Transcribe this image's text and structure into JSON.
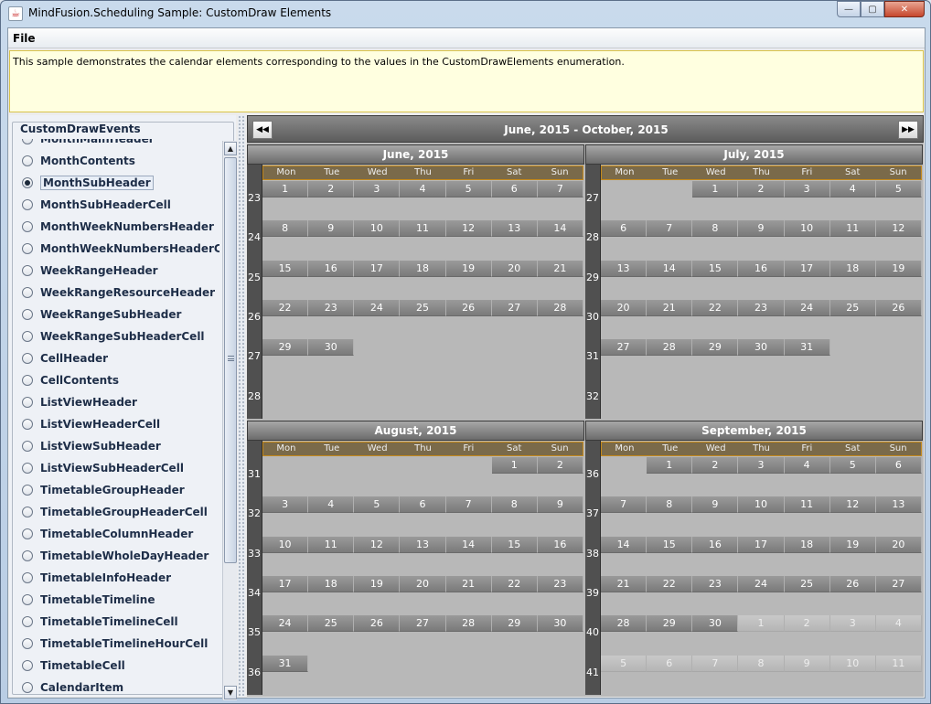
{
  "window": {
    "title": "MindFusion.Scheduling Sample: CustomDraw Elements",
    "icon": "java-cup-icon",
    "min_glyph": "—",
    "max_glyph": "▢",
    "close_glyph": "✕"
  },
  "menu": {
    "file": "File"
  },
  "description": "This sample demonstrates the calendar elements corresponding to the values in the CustomDrawElements enumeration.",
  "left": {
    "group_title": "CustomDrawEvents",
    "selected": "MonthSubHeader",
    "items": [
      {
        "label": "MonthMainHeader",
        "checked": false
      },
      {
        "label": "MonthContents",
        "checked": false
      },
      {
        "label": "MonthSubHeader",
        "checked": true
      },
      {
        "label": "MonthSubHeaderCell",
        "checked": false
      },
      {
        "label": "MonthWeekNumbersHeader",
        "checked": false
      },
      {
        "label": "MonthWeekNumbersHeaderCell",
        "checked": false
      },
      {
        "label": "WeekRangeHeader",
        "checked": false
      },
      {
        "label": "WeekRangeResourceHeader",
        "checked": false
      },
      {
        "label": "WeekRangeSubHeader",
        "checked": false
      },
      {
        "label": "WeekRangeSubHeaderCell",
        "checked": false
      },
      {
        "label": "CellHeader",
        "checked": false
      },
      {
        "label": "CellContents",
        "checked": false
      },
      {
        "label": "ListViewHeader",
        "checked": false
      },
      {
        "label": "ListViewHeaderCell",
        "checked": false
      },
      {
        "label": "ListViewSubHeader",
        "checked": false
      },
      {
        "label": "ListViewSubHeaderCell",
        "checked": false
      },
      {
        "label": "TimetableGroupHeader",
        "checked": false
      },
      {
        "label": "TimetableGroupHeaderCell",
        "checked": false
      },
      {
        "label": "TimetableColumnHeader",
        "checked": false
      },
      {
        "label": "TimetableWholeDayHeader",
        "checked": false
      },
      {
        "label": "TimetableInfoHeader",
        "checked": false
      },
      {
        "label": "TimetableTimeline",
        "checked": false
      },
      {
        "label": "TimetableTimelineCell",
        "checked": false
      },
      {
        "label": "TimetableTimelineHourCell",
        "checked": false
      },
      {
        "label": "TimetableCell",
        "checked": false
      },
      {
        "label": "CalendarItem",
        "checked": false
      }
    ]
  },
  "calendar": {
    "range_title": "June, 2015 - October, 2015",
    "prev_glyph": "◀◀",
    "next_glyph": "▶▶",
    "weekdays": [
      "Mon",
      "Tue",
      "Wed",
      "Thu",
      "Fri",
      "Sat",
      "Sun"
    ],
    "months": [
      {
        "title": "June, 2015",
        "week_numbers": [
          "23",
          "24",
          "25",
          "26",
          "27",
          "28"
        ],
        "rows": [
          [
            [
              "1",
              1
            ],
            [
              "2",
              1
            ],
            [
              "3",
              1
            ],
            [
              "4",
              1
            ],
            [
              "5",
              1
            ],
            [
              "6",
              1
            ],
            [
              "7",
              1
            ]
          ],
          [
            [
              "8",
              1
            ],
            [
              "9",
              1
            ],
            [
              "10",
              1
            ],
            [
              "11",
              1
            ],
            [
              "12",
              1
            ],
            [
              "13",
              1
            ],
            [
              "14",
              1
            ]
          ],
          [
            [
              "15",
              1
            ],
            [
              "16",
              1
            ],
            [
              "17",
              1
            ],
            [
              "18",
              1
            ],
            [
              "19",
              1
            ],
            [
              "20",
              1
            ],
            [
              "21",
              1
            ]
          ],
          [
            [
              "22",
              1
            ],
            [
              "23",
              1
            ],
            [
              "24",
              1
            ],
            [
              "25",
              1
            ],
            [
              "26",
              1
            ],
            [
              "27",
              1
            ],
            [
              "28",
              1
            ]
          ],
          [
            [
              "29",
              1
            ],
            [
              "30",
              1
            ],
            null,
            null,
            null,
            null,
            null
          ],
          [
            null,
            null,
            null,
            null,
            null,
            null,
            null
          ]
        ]
      },
      {
        "title": "July, 2015",
        "week_numbers": [
          "27",
          "28",
          "29",
          "30",
          "31",
          "32"
        ],
        "rows": [
          [
            null,
            null,
            [
              "1",
              1
            ],
            [
              "2",
              1
            ],
            [
              "3",
              1
            ],
            [
              "4",
              1
            ],
            [
              "5",
              1
            ]
          ],
          [
            [
              "6",
              1
            ],
            [
              "7",
              1
            ],
            [
              "8",
              1
            ],
            [
              "9",
              1
            ],
            [
              "10",
              1
            ],
            [
              "11",
              1
            ],
            [
              "12",
              1
            ]
          ],
          [
            [
              "13",
              1
            ],
            [
              "14",
              1
            ],
            [
              "15",
              1
            ],
            [
              "16",
              1
            ],
            [
              "17",
              1
            ],
            [
              "18",
              1
            ],
            [
              "19",
              1
            ]
          ],
          [
            [
              "20",
              1
            ],
            [
              "21",
              1
            ],
            [
              "22",
              1
            ],
            [
              "23",
              1
            ],
            [
              "24",
              1
            ],
            [
              "25",
              1
            ],
            [
              "26",
              1
            ]
          ],
          [
            [
              "27",
              1
            ],
            [
              "28",
              1
            ],
            [
              "29",
              1
            ],
            [
              "30",
              1
            ],
            [
              "31",
              1
            ],
            null,
            null
          ],
          [
            null,
            null,
            null,
            null,
            null,
            null,
            null
          ]
        ]
      },
      {
        "title": "August, 2015",
        "week_numbers": [
          "31",
          "32",
          "33",
          "34",
          "35",
          "36"
        ],
        "rows": [
          [
            null,
            null,
            null,
            null,
            null,
            [
              "1",
              1
            ],
            [
              "2",
              1
            ]
          ],
          [
            [
              "3",
              1
            ],
            [
              "4",
              1
            ],
            [
              "5",
              1
            ],
            [
              "6",
              1
            ],
            [
              "7",
              1
            ],
            [
              "8",
              1
            ],
            [
              "9",
              1
            ]
          ],
          [
            [
              "10",
              1
            ],
            [
              "11",
              1
            ],
            [
              "12",
              1
            ],
            [
              "13",
              1
            ],
            [
              "14",
              1
            ],
            [
              "15",
              1
            ],
            [
              "16",
              1
            ]
          ],
          [
            [
              "17",
              1
            ],
            [
              "18",
              1
            ],
            [
              "19",
              1
            ],
            [
              "20",
              1
            ],
            [
              "21",
              1
            ],
            [
              "22",
              1
            ],
            [
              "23",
              1
            ]
          ],
          [
            [
              "24",
              1
            ],
            [
              "25",
              1
            ],
            [
              "26",
              1
            ],
            [
              "27",
              1
            ],
            [
              "28",
              1
            ],
            [
              "29",
              1
            ],
            [
              "30",
              1
            ]
          ],
          [
            [
              "31",
              1
            ],
            null,
            null,
            null,
            null,
            null,
            null
          ]
        ]
      },
      {
        "title": "September, 2015",
        "week_numbers": [
          "36",
          "37",
          "38",
          "39",
          "40",
          "41"
        ],
        "rows": [
          [
            null,
            [
              "1",
              1
            ],
            [
              "2",
              1
            ],
            [
              "3",
              1
            ],
            [
              "4",
              1
            ],
            [
              "5",
              1
            ],
            [
              "6",
              1
            ]
          ],
          [
            [
              "7",
              1
            ],
            [
              "8",
              1
            ],
            [
              "9",
              1
            ],
            [
              "10",
              1
            ],
            [
              "11",
              1
            ],
            [
              "12",
              1
            ],
            [
              "13",
              1
            ]
          ],
          [
            [
              "14",
              1
            ],
            [
              "15",
              1
            ],
            [
              "16",
              1
            ],
            [
              "17",
              1
            ],
            [
              "18",
              1
            ],
            [
              "19",
              1
            ],
            [
              "20",
              1
            ]
          ],
          [
            [
              "21",
              1
            ],
            [
              "22",
              1
            ],
            [
              "23",
              1
            ],
            [
              "24",
              1
            ],
            [
              "25",
              1
            ],
            [
              "26",
              1
            ],
            [
              "27",
              1
            ]
          ],
          [
            [
              "28",
              1
            ],
            [
              "29",
              1
            ],
            [
              "30",
              1
            ],
            [
              "1",
              0
            ],
            [
              "2",
              0
            ],
            [
              "3",
              0
            ],
            [
              "4",
              0
            ]
          ],
          [
            [
              "5",
              0
            ],
            [
              "6",
              0
            ],
            [
              "7",
              0
            ],
            [
              "8",
              0
            ],
            [
              "9",
              0
            ],
            [
              "10",
              0
            ],
            [
              "11",
              0
            ]
          ]
        ]
      }
    ]
  }
}
